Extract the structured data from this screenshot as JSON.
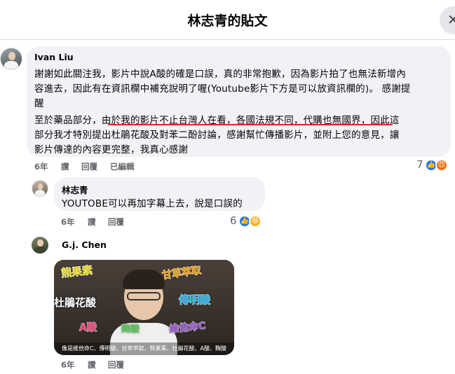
{
  "header": {
    "title": "林志青的貼文",
    "close_icon": "close-icon"
  },
  "colors": {
    "like": "#1877f2",
    "angry": "#e9710f",
    "haha": "#f7b125",
    "underline": "#e0252b",
    "bubble": "#f0f2f5",
    "meta": "#65676b"
  },
  "comments": [
    {
      "author": "Ivan Liu",
      "lines": [
        "謝謝如此關注我，影片中說A酸的確是口誤，真的非常抱歉，因為影片拍了也無法新增內",
        "容進去，因此有在資訊欄中補充說明了喔(Youtube影片下方是可以放資訊欄的)。 感謝提",
        "醒",
        "至於藥品部分，由於我的影片不止台灣人在看，各國法規不同，代購也無國界，因此這",
        "部分我才特別提出杜鵑花酸及對苯二酚討論，感謝幫忙傳播影片，並附上您的意見，讓",
        "影片傳達的內容更完整，我真心感謝"
      ],
      "time": "6年",
      "like_label": "讚",
      "reply_label": "回覆",
      "edited_label": "已編輯",
      "reaction_count": "7",
      "reaction_icons": [
        "like-icon",
        "angry-icon"
      ]
    },
    {
      "author": "林志青",
      "lines": [
        "YOUTOBE可以再加字幕上去，說是口誤的"
      ],
      "time": "6年",
      "like_label": "讚",
      "reply_label": "回覆",
      "reaction_count": "6",
      "reaction_icons": [
        "like-icon",
        "haha-icon"
      ]
    },
    {
      "author": "G.j. Chen",
      "time": "6年",
      "like_label": "讚",
      "reply_label": "回覆",
      "video": {
        "labels": [
          "熊果素",
          "甘草萃取",
          "杜鵑花酸",
          "傳明酸",
          "A酸",
          "麴酸",
          "維他命C"
        ],
        "caption": "像是維他命C、傳明酸、甘草萃取、熊果素、杜鵑花酸、A酸、麴酸"
      }
    }
  ]
}
